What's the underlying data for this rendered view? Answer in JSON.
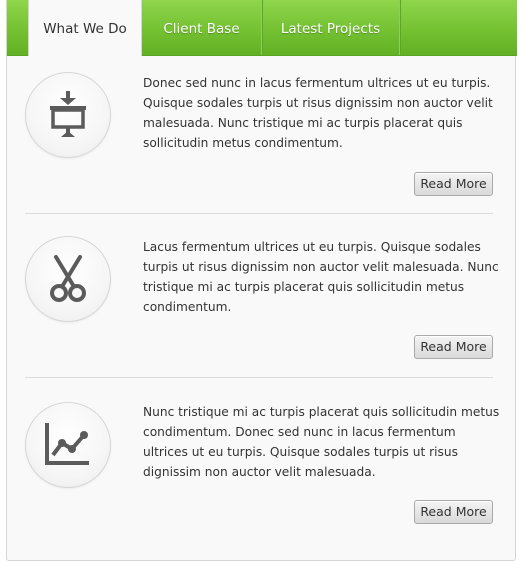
{
  "tabs": [
    {
      "label": "What We Do",
      "active": true
    },
    {
      "label": "Client Base",
      "active": false
    },
    {
      "label": "Latest Projects",
      "active": false
    }
  ],
  "accent_color": "#6cbb2c",
  "items": [
    {
      "icon": "presentation-icon",
      "text": "Donec sed nunc in lacus fermentum ultrices ut eu turpis. Quisque sodales turpis ut risus dignissim non auctor velit malesuada. Nunc tristique mi ac turpis placerat quis sollicitudin metus condimentum.",
      "button": "Read More"
    },
    {
      "icon": "scissors-icon",
      "text": "Lacus fermentum ultrices ut eu turpis. Quisque sodales turpis ut risus dignissim non auctor velit malesuada. Nunc tristique mi ac turpis placerat quis sollicitudin metus condimentum.",
      "button": "Read More"
    },
    {
      "icon": "line-chart-icon",
      "text": "Nunc tristique mi ac turpis placerat quis sollicitudin metus condimentum. Donec sed nunc in lacus fermentum ultrices ut eu turpis. Quisque sodales turpis ut risus dignissim non auctor velit malesuada.",
      "button": "Read More"
    }
  ]
}
